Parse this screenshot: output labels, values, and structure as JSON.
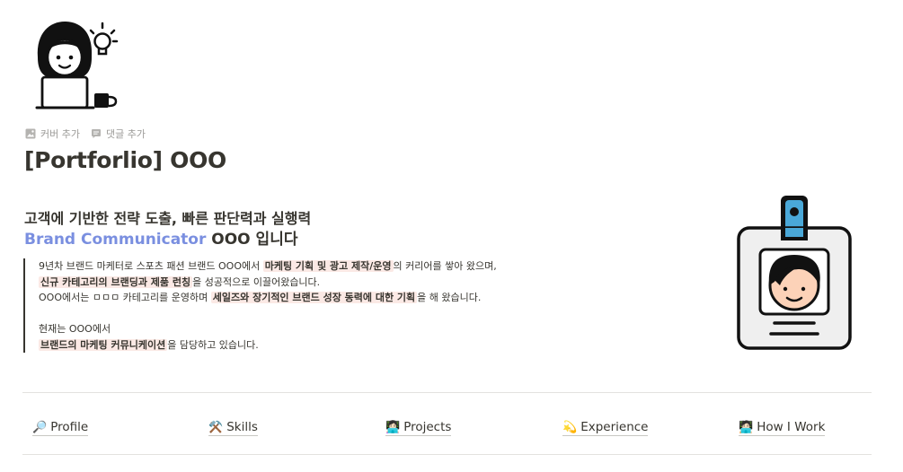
{
  "page": {
    "title": "[Portforlio] OOO",
    "controls": {
      "add_cover": "커버 추가",
      "add_comment": "댓글 추가"
    }
  },
  "intro": {
    "headline": "고객에 기반한 전략 도출, 빠른 판단력과 실행력",
    "brand": "Brand Communicator",
    "brand_suffix": " OOO 입니다"
  },
  "quote": {
    "l1_a": "9년차 브랜드 마케터로 스포츠 패션 브랜드 OOO에서 ",
    "l1_hl": "마케팅 기획 및 광고 제작/운영",
    "l1_b": "의 커리어를 쌓아 왔으며,",
    "l2_hl": "신규 카테고리의 브랜딩과 제품 런칭",
    "l2_b": "을 성공적으로 이끌어왔습니다.",
    "l3_a": "OOO에서는 ㅁㅁㅁ 카테고리를 운영하며 ",
    "l3_hl": "세일즈와 장기적인 브랜드 성장 동력에 대한 기획",
    "l3_b": "을 해 왔습니다.",
    "l4": "현재는 OOO에서",
    "l5_hl": "브랜드의 마케팅 커뮤니케이션",
    "l5_b": "을 담당하고 있습니다."
  },
  "nav": [
    {
      "emoji": "🔎",
      "label": "Profile"
    },
    {
      "emoji": "⚒️",
      "label": "Skills"
    },
    {
      "emoji": "👩🏻‍💻",
      "label": "Projects"
    },
    {
      "emoji": "💫",
      "label": "Experience"
    },
    {
      "emoji": "🧑🏻‍💻",
      "label": "How I Work"
    }
  ],
  "colors": {
    "accent": "#7a8fe0",
    "highlight": "#fbe9e5",
    "text": "#37352f",
    "muted": "#9b9a97"
  },
  "icons": {
    "page_icon": "woman-with-laptop-icon",
    "badge_icon": "id-badge-icon"
  }
}
